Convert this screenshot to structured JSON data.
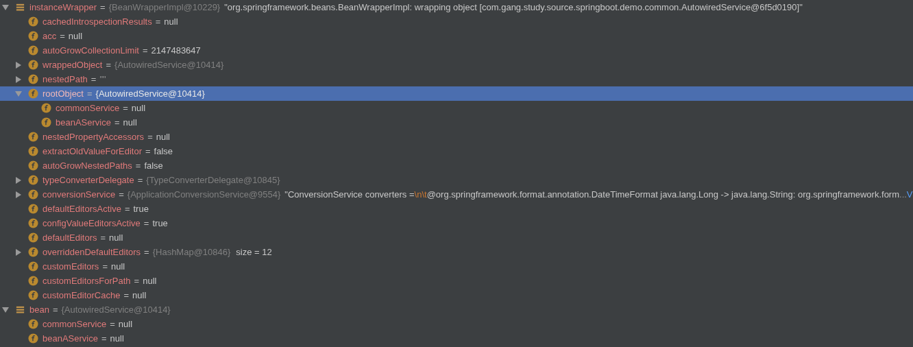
{
  "variables": [
    {
      "kind": "local",
      "name": "instanceWrapper",
      "sep": "=",
      "type": "{BeanWrapperImpl@10229}",
      "value": [
        {
          "kind": "string",
          "text": "\"org.springframework.beans.BeanWrapperImpl: wrapping object [com.gang.study.source.springboot.demo.common.AutowiredService@6f5d0190]\""
        }
      ],
      "expanded": true,
      "selected": false,
      "children": [
        {
          "kind": "field",
          "name": "cachedIntrospectionResults",
          "sep": "=",
          "value": [
            {
              "kind": "plain",
              "text": "null"
            }
          ],
          "selected": false
        },
        {
          "kind": "field",
          "name": "acc",
          "sep": "=",
          "value": [
            {
              "kind": "plain",
              "text": "null"
            }
          ],
          "selected": false
        },
        {
          "kind": "field",
          "name": "autoGrowCollectionLimit",
          "sep": "=",
          "value": [
            {
              "kind": "plain",
              "text": "2147483647"
            }
          ],
          "selected": false
        },
        {
          "kind": "field",
          "name": "wrappedObject",
          "sep": "=",
          "type": "{AutowiredService@10414}",
          "expanded": false,
          "selected": false
        },
        {
          "kind": "field",
          "name": "nestedPath",
          "sep": "=",
          "value": [
            {
              "kind": "muted",
              "text": "\"\""
            }
          ],
          "expanded": false,
          "selected": false
        },
        {
          "kind": "field",
          "name": "rootObject",
          "sep": "=",
          "type": "{AutowiredService@10414}",
          "expanded": true,
          "selected": true,
          "children": [
            {
              "kind": "field",
              "name": "commonService",
              "sep": "=",
              "value": [
                {
                  "kind": "plain",
                  "text": "null"
                }
              ],
              "selected": false
            },
            {
              "kind": "field",
              "name": "beanAService",
              "sep": "=",
              "value": [
                {
                  "kind": "plain",
                  "text": "null"
                }
              ],
              "selected": false
            }
          ]
        },
        {
          "kind": "field",
          "name": "nestedPropertyAccessors",
          "sep": "=",
          "value": [
            {
              "kind": "plain",
              "text": "null"
            }
          ],
          "selected": false
        },
        {
          "kind": "field",
          "name": "extractOldValueForEditor",
          "sep": "=",
          "value": [
            {
              "kind": "plain",
              "text": "false"
            }
          ],
          "selected": false
        },
        {
          "kind": "field",
          "name": "autoGrowNestedPaths",
          "sep": "=",
          "value": [
            {
              "kind": "plain",
              "text": "false"
            }
          ],
          "selected": false
        },
        {
          "kind": "field",
          "name": "typeConverterDelegate",
          "sep": "=",
          "type": "{TypeConverterDelegate@10845}",
          "expanded": false,
          "selected": false
        },
        {
          "kind": "field",
          "name": "conversionService",
          "sep": "=",
          "type": "{ApplicationConversionService@9554}",
          "value": [
            {
              "kind": "string",
              "text": "\"ConversionService converters ="
            },
            {
              "kind": "escape",
              "text": "\\n\\t"
            },
            {
              "kind": "string",
              "text": "@org.springframework.format.annotation.DateTimeFormat java.lang.Long -> java.lang.String: org.springframework.form"
            },
            {
              "kind": "muted",
              "text": "..."
            },
            {
              "kind": "link",
              "text": "V"
            }
          ],
          "expanded": false,
          "selected": false
        },
        {
          "kind": "field",
          "name": "defaultEditorsActive",
          "sep": "=",
          "value": [
            {
              "kind": "plain",
              "text": "true"
            }
          ],
          "selected": false
        },
        {
          "kind": "field",
          "name": "configValueEditorsActive",
          "sep": "=",
          "value": [
            {
              "kind": "plain",
              "text": "true"
            }
          ],
          "selected": false
        },
        {
          "kind": "field",
          "name": "defaultEditors",
          "sep": "=",
          "value": [
            {
              "kind": "plain",
              "text": "null"
            }
          ],
          "selected": false
        },
        {
          "kind": "field",
          "name": "overriddenDefaultEditors",
          "sep": "=",
          "type": "{HashMap@10846}",
          "value": [
            {
              "kind": "plain",
              "text": "size = 12"
            }
          ],
          "expanded": false,
          "selected": false
        },
        {
          "kind": "field",
          "name": "customEditors",
          "sep": "=",
          "value": [
            {
              "kind": "plain",
              "text": "null"
            }
          ],
          "selected": false
        },
        {
          "kind": "field",
          "name": "customEditorsForPath",
          "sep": "=",
          "value": [
            {
              "kind": "plain",
              "text": "null"
            }
          ],
          "selected": false
        },
        {
          "kind": "field",
          "name": "customEditorCache",
          "sep": "=",
          "value": [
            {
              "kind": "plain",
              "text": "null"
            }
          ],
          "selected": false
        }
      ]
    },
    {
      "kind": "local",
      "name": "bean",
      "sep": "=",
      "type": "{AutowiredService@10414}",
      "expanded": true,
      "selected": false,
      "children": [
        {
          "kind": "field",
          "name": "commonService",
          "sep": "=",
          "value": [
            {
              "kind": "plain",
              "text": "null"
            }
          ],
          "selected": false
        },
        {
          "kind": "field",
          "name": "beanAService",
          "sep": "=",
          "value": [
            {
              "kind": "plain",
              "text": "null"
            }
          ],
          "selected": false
        }
      ]
    }
  ]
}
